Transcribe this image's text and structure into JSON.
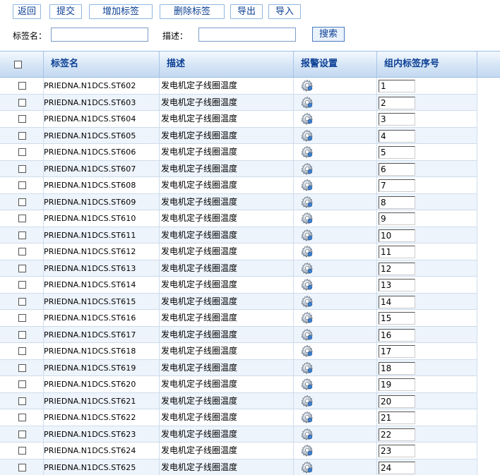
{
  "toolbar": {
    "back": "返回",
    "submit": "提交",
    "add_tag": "增加标签",
    "delete_tag": "删除标签",
    "export": "导出",
    "import": "导入"
  },
  "search": {
    "tag_name_label": "标签名：",
    "tag_name_value": "",
    "desc_label": "描述：",
    "desc_value": "",
    "button": "搜索"
  },
  "table": {
    "headers": {
      "tag_name": "标签名",
      "description": "描述",
      "alarm": "报警设置",
      "order": "组内标签序号"
    },
    "rows": [
      {
        "name": "PRIEDNA.N1DCS.ST602",
        "desc": "发电机定子线圈温度",
        "order": "1"
      },
      {
        "name": "PRIEDNA.N1DCS.ST603",
        "desc": "发电机定子线圈温度",
        "order": "2"
      },
      {
        "name": "PRIEDNA.N1DCS.ST604",
        "desc": "发电机定子线圈温度",
        "order": "3"
      },
      {
        "name": "PRIEDNA.N1DCS.ST605",
        "desc": "发电机定子线圈温度",
        "order": "4"
      },
      {
        "name": "PRIEDNA.N1DCS.ST606",
        "desc": "发电机定子线圈温度",
        "order": "5"
      },
      {
        "name": "PRIEDNA.N1DCS.ST607",
        "desc": "发电机定子线圈温度",
        "order": "6"
      },
      {
        "name": "PRIEDNA.N1DCS.ST608",
        "desc": "发电机定子线圈温度",
        "order": "7"
      },
      {
        "name": "PRIEDNA.N1DCS.ST609",
        "desc": "发电机定子线圈温度",
        "order": "8"
      },
      {
        "name": "PRIEDNA.N1DCS.ST610",
        "desc": "发电机定子线圈温度",
        "order": "9"
      },
      {
        "name": "PRIEDNA.N1DCS.ST611",
        "desc": "发电机定子线圈温度",
        "order": "10"
      },
      {
        "name": "PRIEDNA.N1DCS.ST612",
        "desc": "发电机定子线圈温度",
        "order": "11"
      },
      {
        "name": "PRIEDNA.N1DCS.ST613",
        "desc": "发电机定子线圈温度",
        "order": "12"
      },
      {
        "name": "PRIEDNA.N1DCS.ST614",
        "desc": "发电机定子线圈温度",
        "order": "13"
      },
      {
        "name": "PRIEDNA.N1DCS.ST615",
        "desc": "发电机定子线圈温度",
        "order": "14"
      },
      {
        "name": "PRIEDNA.N1DCS.ST616",
        "desc": "发电机定子线圈温度",
        "order": "15"
      },
      {
        "name": "PRIEDNA.N1DCS.ST617",
        "desc": "发电机定子线圈温度",
        "order": "16"
      },
      {
        "name": "PRIEDNA.N1DCS.ST618",
        "desc": "发电机定子线圈温度",
        "order": "17"
      },
      {
        "name": "PRIEDNA.N1DCS.ST619",
        "desc": "发电机定子线圈温度",
        "order": "18"
      },
      {
        "name": "PRIEDNA.N1DCS.ST620",
        "desc": "发电机定子线圈温度",
        "order": "19"
      },
      {
        "name": "PRIEDNA.N1DCS.ST621",
        "desc": "发电机定子线圈温度",
        "order": "20"
      },
      {
        "name": "PRIEDNA.N1DCS.ST622",
        "desc": "发电机定子线圈温度",
        "order": "21"
      },
      {
        "name": "PRIEDNA.N1DCS.ST623",
        "desc": "发电机定子线圈温度",
        "order": "22"
      },
      {
        "name": "PRIEDNA.N1DCS.ST624",
        "desc": "发电机定子线圈温度",
        "order": "23"
      },
      {
        "name": "PRIEDNA.N1DCS.ST625",
        "desc": "发电机定子线圈温度",
        "order": "24"
      }
    ]
  },
  "icons": {
    "alarm": "gear-icon"
  },
  "colors": {
    "header_text": "#0b3f94",
    "row_alt": "#edf4fc",
    "button_border": "#8fb6e0"
  }
}
